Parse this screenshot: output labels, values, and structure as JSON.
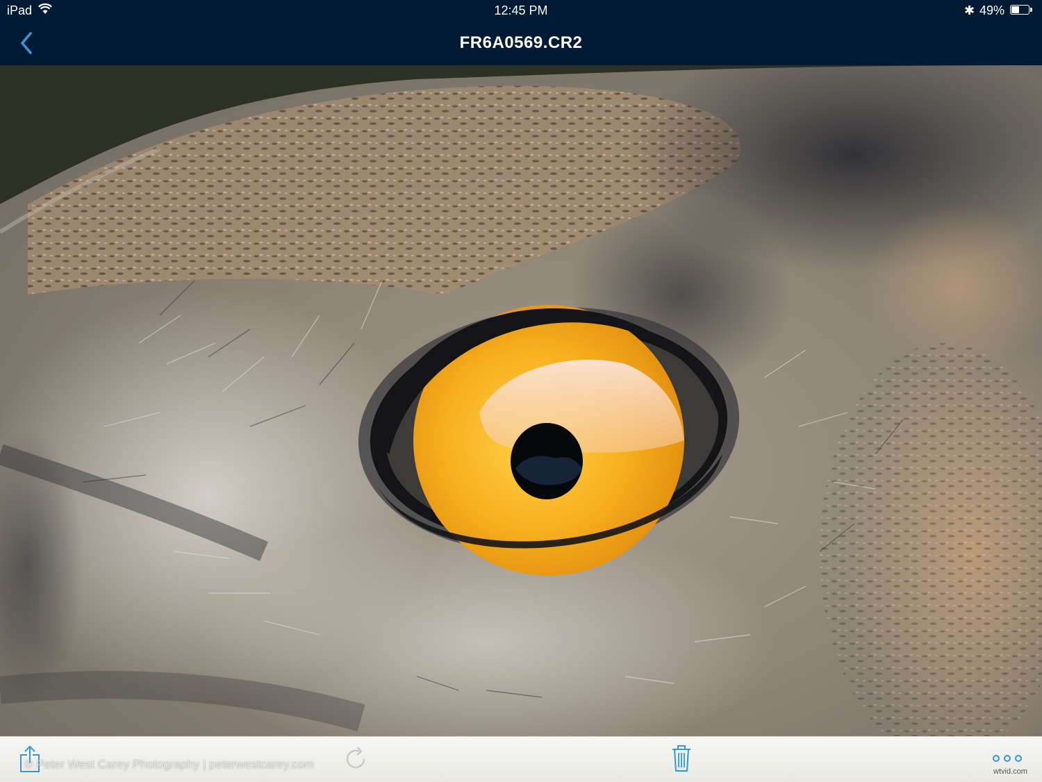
{
  "status_bar": {
    "carrier": "iPad",
    "time": "12:45 PM",
    "bluetooth": "✱",
    "battery_percent": "49%",
    "battery_level": 0.49
  },
  "nav": {
    "back_icon": "chevron-left-icon",
    "title": "FR6A0569.CR2"
  },
  "photo": {
    "subject": "owl-eye-photo"
  },
  "toolbar": {
    "share_icon": "share-icon",
    "rotate_icon": "rotate-icon",
    "delete_icon": "trash-icon",
    "more_icon": "more-icon",
    "watermark": "© Peter West Carey Photography | peterwestcarey.com"
  },
  "site_mark": "wtvid.com",
  "colors": {
    "nav_background": "#011a33",
    "accent": "#2e9ad6",
    "iris": "#f5a316"
  }
}
